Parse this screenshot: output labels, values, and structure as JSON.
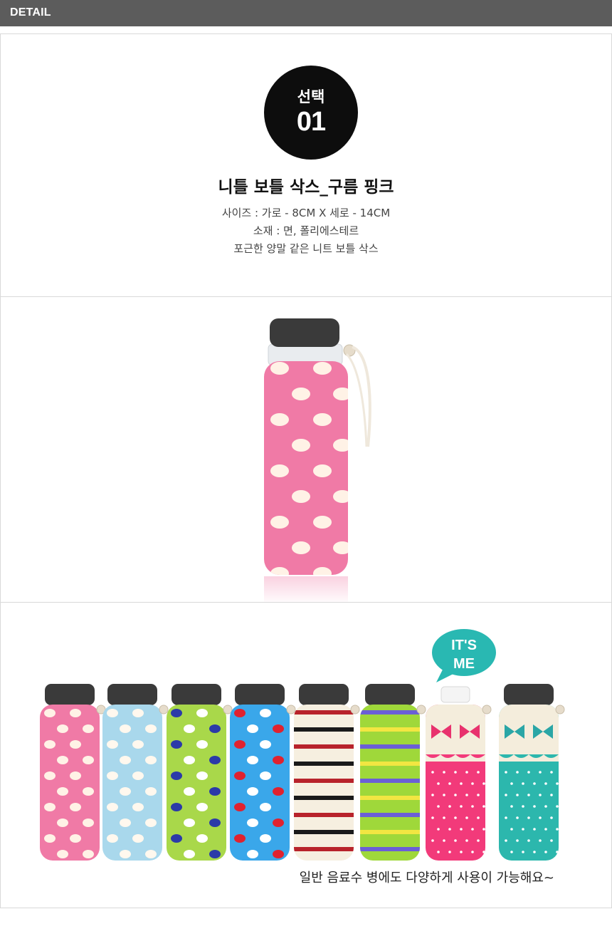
{
  "header": {
    "label": "DETAIL"
  },
  "badge": {
    "top": "선택",
    "number": "01"
  },
  "product": {
    "title": "니틀 보틀 삭스_구름 핑크",
    "specs": [
      "사이즈 : 가로 - 8CM X 세로 - 14CM",
      "소재 : 면, 폴리에스테르",
      "포근한 양말 같은 니트 보틀 삭스"
    ]
  },
  "lineup": {
    "speech_bubble": {
      "line1": "IT'S",
      "line2": "ME"
    },
    "caption": "일반 음료수 병에도 다양하게 사용이 가능해요~",
    "variants": [
      {
        "pattern": "dots",
        "bg": "#f07aa6",
        "dot": "#fff2e6",
        "dot2": "#fff2e6"
      },
      {
        "pattern": "dots",
        "bg": "#a9d8ec",
        "dot": "#fff8ee",
        "dot2": "#fff8ee"
      },
      {
        "pattern": "dots",
        "bg": "#a9d84a",
        "dot": "#2b3aa8",
        "dot2": "#ffffff"
      },
      {
        "pattern": "dots",
        "bg": "#3aa7ea",
        "dot": "#e0222f",
        "dot2": "#ffffff"
      },
      {
        "pattern": "stripes",
        "bg": "#f6efe0",
        "stripes": [
          "#b8232b",
          "#1a1a1a",
          "#b8232b",
          "#1a1a1a",
          "#b8232b",
          "#1a1a1a",
          "#b8232b",
          "#1a1a1a",
          "#b8232b"
        ]
      },
      {
        "pattern": "stripes",
        "bg": "#9fd83a",
        "stripes": [
          "#6b5fd6",
          "#f2e642",
          "#6b5fd6",
          "#f2e642",
          "#6b5fd6",
          "#f2e642",
          "#6b5fd6",
          "#f2e642",
          "#6b5fd6"
        ]
      },
      {
        "pattern": "ribbon",
        "bg": "#f23a7a",
        "top": "#f4eddc",
        "ribbon": "#e8326e"
      },
      {
        "pattern": "ribbon",
        "bg": "#2cb7ad",
        "top": "#f4eddc",
        "ribbon": "#2aa6a6"
      }
    ]
  },
  "colors": {
    "header_bg": "#5c5c5c",
    "hero_sleeve": "#f07aa6",
    "hero_dot": "#fff2e6",
    "bubble": "#29b8b2"
  }
}
